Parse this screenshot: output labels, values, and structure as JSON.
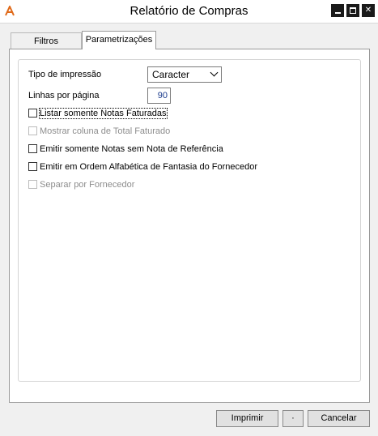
{
  "window": {
    "title": "Relatório de Compras",
    "app_icon": "app-logo-icon",
    "controls": {
      "minimize": "minimize-icon",
      "maximize": "maximize-icon",
      "close": "close-icon",
      "close_glyph": "✕"
    }
  },
  "tabs": [
    {
      "label": "Filtros",
      "active": false
    },
    {
      "label": "Parametrizações",
      "active": true
    }
  ],
  "form": {
    "tipo_impressao": {
      "label": "Tipo de impressão",
      "value": "Caracter"
    },
    "linhas_por_pagina": {
      "label": "Linhas por página",
      "value": "90"
    }
  },
  "checkboxes": [
    {
      "label": "Listar somente Notas Faturadas",
      "checked": false,
      "enabled": true
    },
    {
      "label": "Mostrar coluna de Total Faturado",
      "checked": false,
      "enabled": false
    },
    {
      "label": "Emitir somente Notas sem Nota de Referência",
      "checked": false,
      "enabled": true
    },
    {
      "label": "Emitir em Ordem Alfabética de Fantasia do Fornecedor",
      "checked": false,
      "enabled": true
    },
    {
      "label": "Separar por Fornecedor",
      "checked": false,
      "enabled": false
    }
  ],
  "buttons": {
    "imprimir": "Imprimir",
    "dot": "·",
    "cancelar": "Cancelar"
  }
}
